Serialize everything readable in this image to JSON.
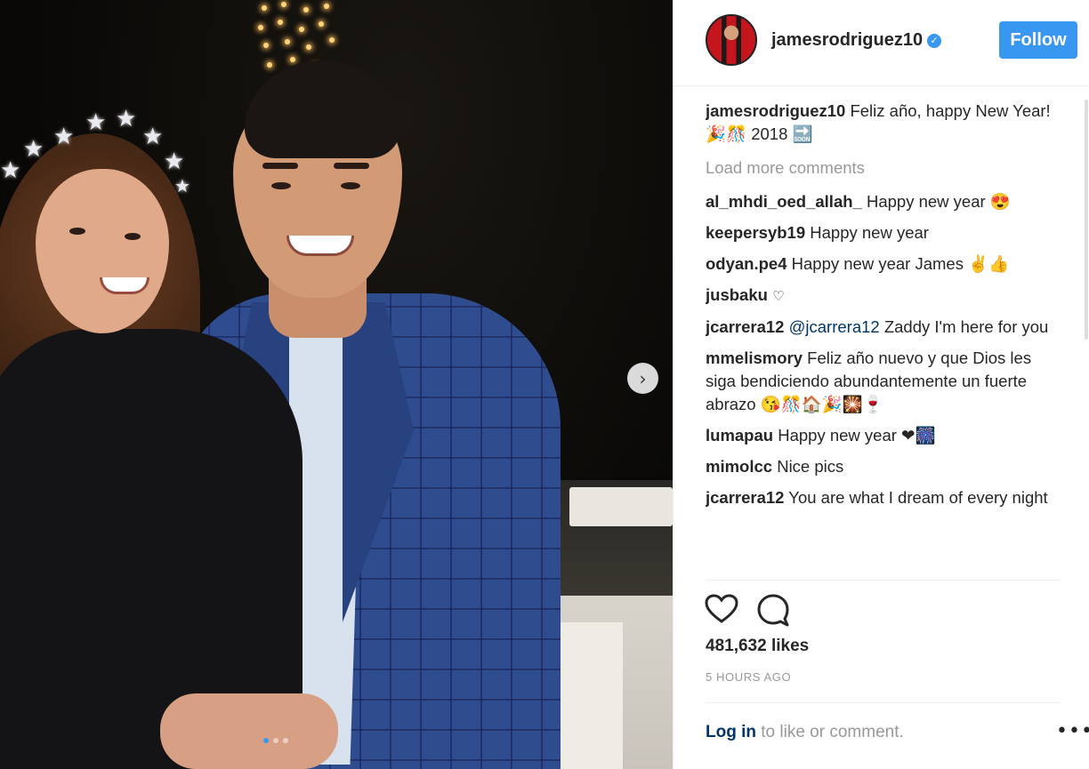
{
  "post": {
    "slide_index": 1,
    "slide_count": 3
  },
  "header": {
    "username": "jamesrodriguez10",
    "follow_label": "Follow"
  },
  "caption": {
    "username": "jamesrodriguez10",
    "text": "Feliz año, happy New Year! 🎉🎊 2018 🔜"
  },
  "load_more": "Load more comments",
  "comments": [
    {
      "user": "al_mhdi_oed_allah_",
      "text": "Happy new year 😍"
    },
    {
      "user": "keepersyb19",
      "text": "Happy new year"
    },
    {
      "user": "odyan.pe4",
      "text": "Happy new year James ✌👍"
    },
    {
      "user": "jusbaku",
      "text": "♡"
    },
    {
      "user": "jcarrera12",
      "mention": "@jcarrera12",
      "text": " Zaddy I'm here for you"
    },
    {
      "user": "mmelismory",
      "text": "Feliz año nuevo y que Dios les siga bendiciendo abundantemente un fuerte abrazo 😘🎊🏠🎉🎇🍷"
    },
    {
      "user": "lumapau",
      "text": "Happy new year ❤🎆"
    },
    {
      "user": "mimolcc",
      "text": "Nice pics"
    },
    {
      "user": "jcarrera12",
      "text": "You are what I dream of every night"
    }
  ],
  "likes": "481,632 likes",
  "time_ago": "5 HOURS AGO",
  "footer": {
    "login_link": "Log in",
    "login_rest": " to like or comment.",
    "more": "•••"
  },
  "icons": {
    "heart": "heart-icon",
    "comment": "comment-icon",
    "next": "chevron-right-icon",
    "verified": "verified-badge-icon"
  },
  "colors": {
    "accent": "#3897f0",
    "link": "#003569",
    "muted": "#999999"
  }
}
